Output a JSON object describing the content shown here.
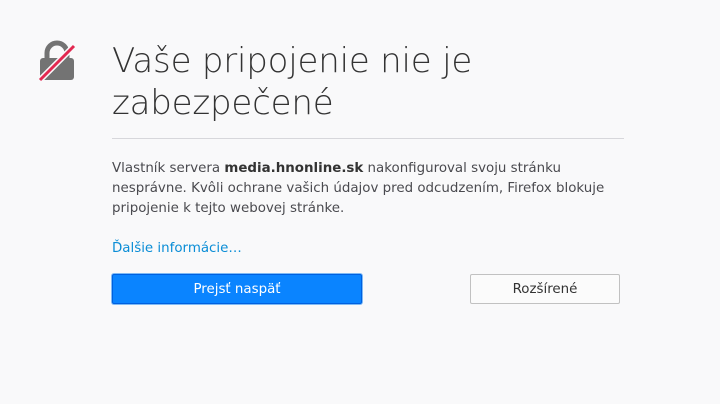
{
  "error": {
    "title": "Vaše pripojenie nie je zabezpečené",
    "description_prefix": "Vlastník servera ",
    "host": "media.hnonline.sk",
    "description_suffix": " nakonfiguroval svoju stránku nesprávne. Kvôli ochrane vašich údajov pred odcudzením, Firefox blokuje pripojenie k tejto webovej stránke.",
    "more_info_link": "Ďalšie informácie…",
    "go_back_button": "Prejsť naspäť",
    "advanced_button": "Rozšírené"
  },
  "icon": "broken-lock-icon",
  "colors": {
    "background": "#f9f9fa",
    "lock_gray": "#737373",
    "strike_red": "#e22850",
    "link": "#0a8dd6",
    "primary_button": "#0a84ff"
  }
}
